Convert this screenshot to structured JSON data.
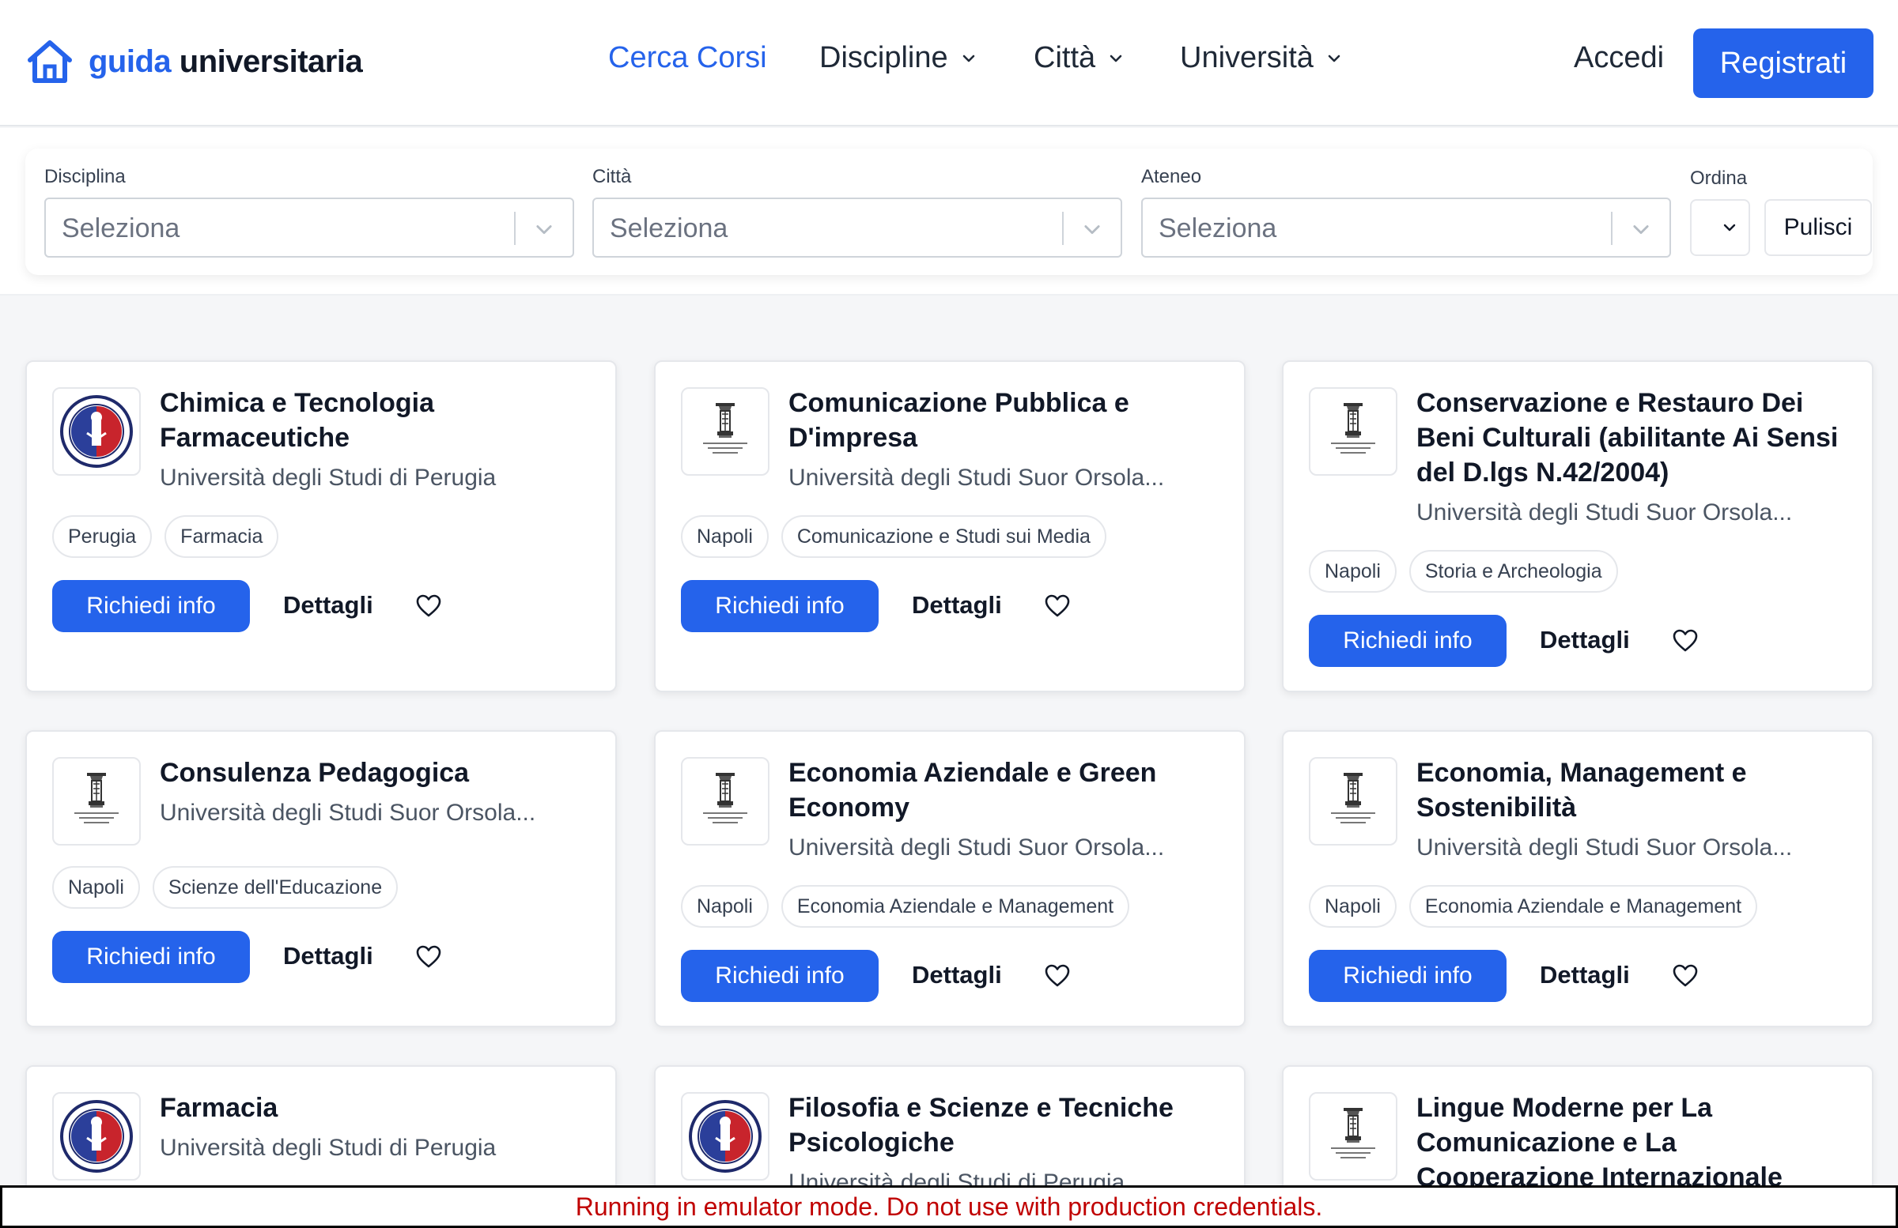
{
  "brand": {
    "part1": "guida",
    "part2": "universitaria"
  },
  "nav": {
    "items": [
      "Cerca Corsi",
      "Discipline",
      "Città",
      "Università"
    ],
    "login": "Accedi",
    "register": "Registrati"
  },
  "filters": {
    "disciplina_label": "Disciplina",
    "citta_label": "Città",
    "ateneo_label": "Ateneo",
    "ordina_label": "Ordina",
    "placeholder": "Seleziona",
    "clear": "Pulisci"
  },
  "card_actions": {
    "info": "Richiedi info",
    "details": "Dettagli"
  },
  "courses": [
    {
      "title": "Chimica e Tecnologia Farmaceutiche",
      "university": "Università degli Studi di Perugia",
      "tags": [
        "Perugia",
        "Farmacia"
      ],
      "logo": "perugia-seal"
    },
    {
      "title": "Comunicazione Pubblica e D'impresa",
      "university": "Università degli Studi Suor Orsola...",
      "tags": [
        "Napoli",
        "Comunicazione e Studi sui Media"
      ],
      "logo": "suor-orsola-seal"
    },
    {
      "title": "Conservazione e Restauro Dei Beni Culturali (abilitante Ai Sensi del D.lgs N.42/2004)",
      "university": "Università degli Studi Suor Orsola...",
      "tags": [
        "Napoli",
        "Storia e Archeologia"
      ],
      "logo": "suor-orsola-seal"
    },
    {
      "title": "Consulenza Pedagogica",
      "university": "Università degli Studi Suor Orsola...",
      "tags": [
        "Napoli",
        "Scienze dell'Educazione"
      ],
      "logo": "suor-orsola-seal"
    },
    {
      "title": "Economia Aziendale e Green Economy",
      "university": "Università degli Studi Suor Orsola...",
      "tags": [
        "Napoli",
        "Economia Aziendale e Management"
      ],
      "logo": "suor-orsola-seal"
    },
    {
      "title": "Economia, Management e Sostenibilità",
      "university": "Università degli Studi Suor Orsola...",
      "tags": [
        "Napoli",
        "Economia Aziendale e Management"
      ],
      "logo": "suor-orsola-seal"
    },
    {
      "title": "Farmacia",
      "university": "Università degli Studi di Perugia",
      "tags": [],
      "logo": "perugia-seal"
    },
    {
      "title": "Filosofia e Scienze e Tecniche Psicologiche",
      "university": "Università degli Studi di Perugia",
      "tags": [],
      "logo": "perugia-seal"
    },
    {
      "title": "Lingue Moderne per La Comunicazione e La Cooperazione Internazionale",
      "university": "",
      "tags": [],
      "logo": "suor-orsola-seal"
    }
  ],
  "banner": "Running in emulator mode. Do not use with production credentials.",
  "colors": {
    "accent": "#2563eb",
    "banner_text": "#c00000"
  }
}
